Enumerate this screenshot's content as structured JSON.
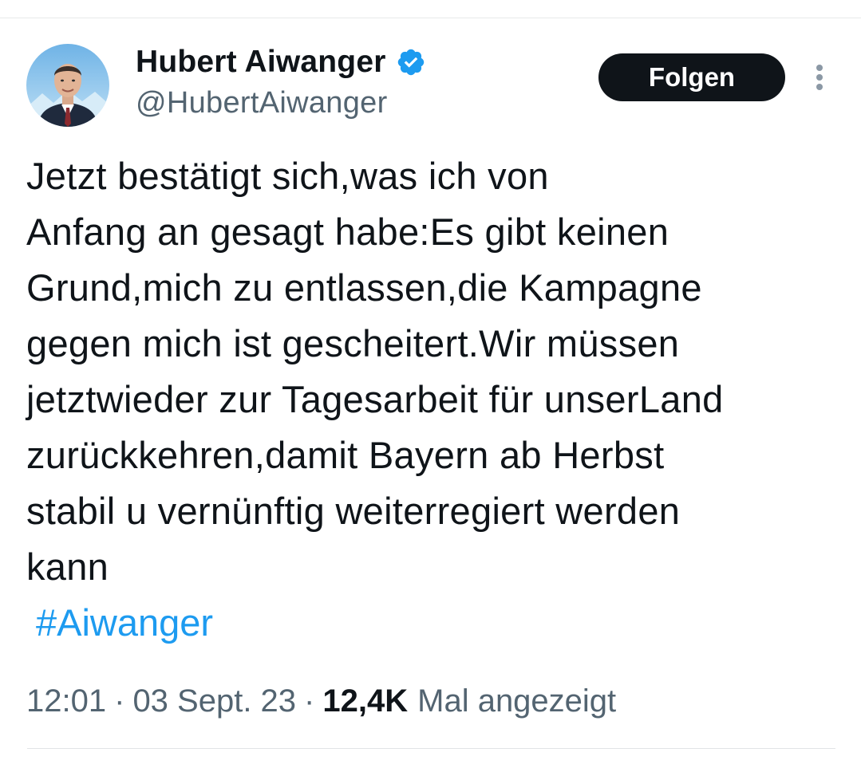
{
  "author": {
    "name": "Hubert Aiwanger",
    "handle": "@HubertAiwanger",
    "verified": true,
    "verified_color": "#1d9bf0",
    "avatar_icon": "profile-photo"
  },
  "actions": {
    "follow_label": "Folgen",
    "more_icon": "more-vertical-icon"
  },
  "tweet": {
    "lines": [
      "Jetzt bestätigt sich,was ich von",
      "Anfang an gesagt habe:Es gibt keinen",
      "Grund,mich zu entlassen,die Kampagne",
      "gegen mich ist gescheitert.Wir müssen",
      "jetztwieder zur Tagesarbeit für unserLand",
      "zurückkehren,damit Bayern ab Herbst",
      "stabil u vernünftig weiterregiert werden",
      "kann"
    ],
    "hashtag": "#Aiwanger",
    "hashtag_color": "#1d9bf0"
  },
  "meta": {
    "time": "12:01",
    "separator": "·",
    "date": "03 Sept. 23",
    "views_count": "12,4K",
    "views_label": "Mal angezeigt"
  }
}
